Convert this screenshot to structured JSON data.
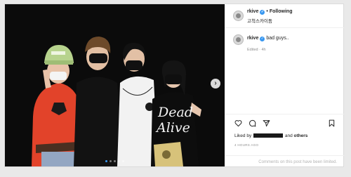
{
  "header": {
    "username": "rkive",
    "separator": "•",
    "follow_label": "Following",
    "location": "고척스카이돔"
  },
  "caption": {
    "username": "rkive",
    "text": "bad guys..",
    "meta": "Edited · 4h"
  },
  "photo": {
    "shirt_text": "Dead\nAlive",
    "carousel_count": 5,
    "carousel_active": 0
  },
  "likes": {
    "prefix": "Liked by",
    "joiner": "and",
    "others_label": "others"
  },
  "time_label": "4 HOURS AGO",
  "comments_notice": "Comments on this post have been limited.",
  "colors": {
    "accent": "#3897f0",
    "photo_bg": "#0b0b0b"
  },
  "icons": {
    "nav": "chevron-right-icon",
    "like": "heart-icon",
    "comment": "comment-icon",
    "share": "paper-plane-icon",
    "save": "bookmark-icon",
    "verified": "verified-badge-icon"
  }
}
